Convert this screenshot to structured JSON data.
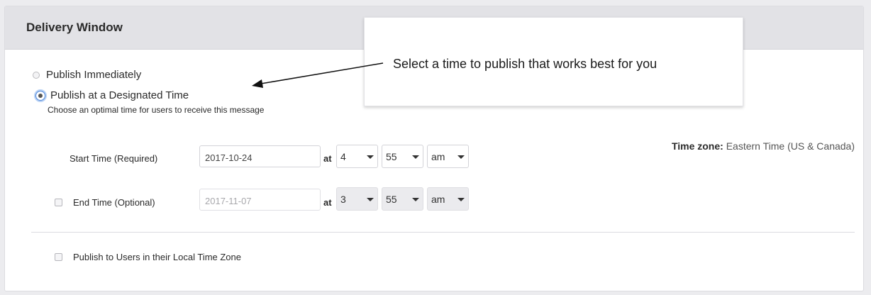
{
  "panel": {
    "title": "Delivery Window"
  },
  "delivery_options": [
    {
      "label": "Publish Immediately",
      "selected": false
    },
    {
      "label": "Publish at a Designated Time",
      "selected": true
    }
  ],
  "helper_text": "Choose an optimal time for users to receive this message",
  "start_time": {
    "label": "Start Time (Required)",
    "date": "2017-10-24",
    "at_label": "at",
    "hour": "4",
    "minute": "55",
    "ampm": "am"
  },
  "end_time": {
    "label": "End Time (Optional)",
    "checked": false,
    "date": "2017-11-07",
    "at_label": "at",
    "hour": "3",
    "minute": "55",
    "ampm": "am"
  },
  "timezone": {
    "label": "Time zone:",
    "value": "Eastern Time (US & Canada)"
  },
  "local_timezone": {
    "label": "Publish to Users in their Local Time Zone",
    "checked": false
  },
  "callout": {
    "text": "Select a time to publish that works best for you"
  },
  "colors": {
    "accent": "#4f86d8",
    "header_bg": "#e2e2e6",
    "disabled_select_bg": "#ebebee"
  }
}
